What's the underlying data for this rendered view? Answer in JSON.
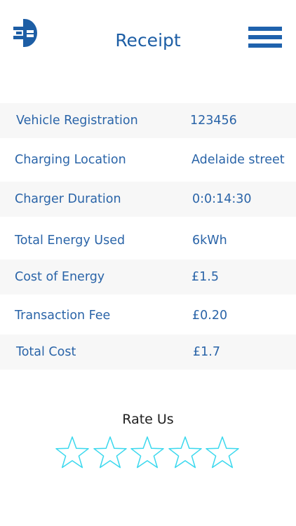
{
  "header": {
    "title": "Receipt",
    "logo_icon": "plug-logo-icon",
    "menu_icon": "hamburger-menu-icon",
    "brand_color": "#1d5ea5"
  },
  "receipt": {
    "rows": [
      {
        "label": "Vehicle Registration",
        "value": "123456"
      },
      {
        "label": "Charging Location",
        "value": "Adelaide street"
      },
      {
        "label": "Charger Duration",
        "value": "0:0:14:30"
      },
      {
        "label": "Total Energy Used",
        "value": "6kWh"
      },
      {
        "label": "Cost of Energy",
        "value": "£1.5"
      },
      {
        "label": "Transaction Fee",
        "value": "£0.20"
      },
      {
        "label": "Total Cost",
        "value": "£1.7"
      }
    ]
  },
  "rating": {
    "title": "Rate Us",
    "max_stars": 5,
    "selected": 0,
    "star_color": "#3ad8ee"
  }
}
